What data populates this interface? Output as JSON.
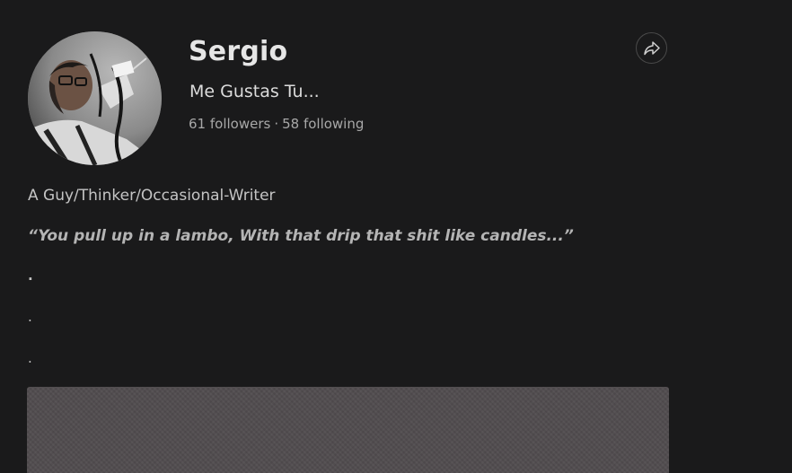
{
  "profile": {
    "name": "Sergio",
    "tagline": "Me Gustas Tu...",
    "followers": "61 followers",
    "separator": "·",
    "following": "58 following",
    "bio": "A Guy/Thinker/Occasional-Writer",
    "quote": "“You pull up in a lambo, With that drip that shit like candles...”",
    "dots": [
      ".",
      ".",
      "."
    ]
  },
  "icons": {
    "share": "share-icon",
    "avatar": "avatar-photo"
  },
  "colors": {
    "background": "#1a1a1b",
    "cover": "#514c4f"
  }
}
